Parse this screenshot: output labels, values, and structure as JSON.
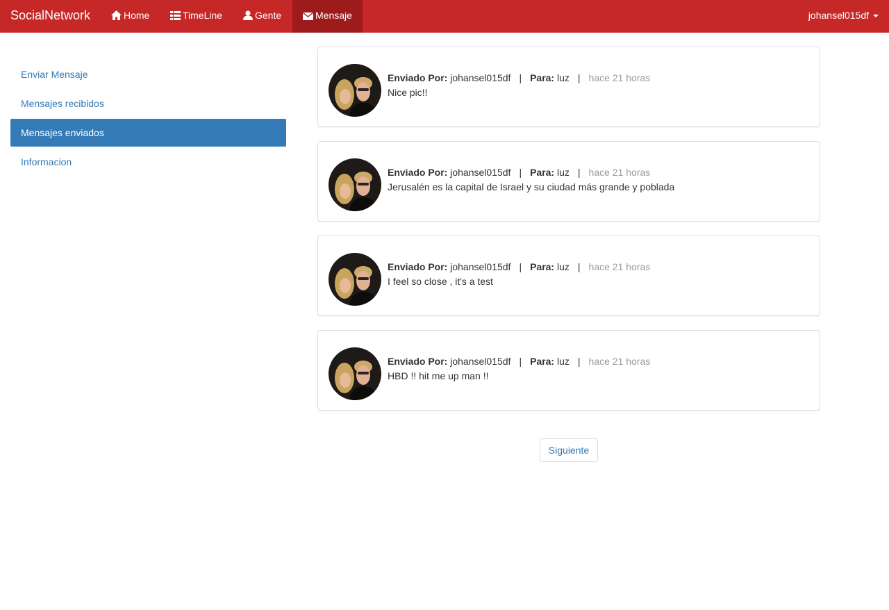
{
  "navbar": {
    "brand": "SocialNetwork",
    "items": [
      {
        "label": "Home",
        "icon": "home-icon"
      },
      {
        "label": "TimeLine",
        "icon": "list-icon"
      },
      {
        "label": "Gente",
        "icon": "user-icon"
      },
      {
        "label": "Mensaje",
        "icon": "envelope-icon",
        "active": true
      }
    ],
    "user": "johansel015df",
    "accent_color": "#c62828",
    "active_color": "#9e1b1b"
  },
  "sidebar": {
    "items": [
      {
        "label": "Enviar Mensaje"
      },
      {
        "label": "Mensajes recibidos"
      },
      {
        "label": "Mensajes enviados",
        "active": true
      },
      {
        "label": "Informacion"
      }
    ]
  },
  "messages": [
    {
      "sender_label": "Enviado Por:",
      "sender": "johansel015df",
      "to_label": "Para:",
      "to": "luz",
      "time": "hace 21 horas",
      "text": "Nice pic!!"
    },
    {
      "sender_label": "Enviado Por:",
      "sender": "johansel015df",
      "to_label": "Para:",
      "to": "luz",
      "time": "hace 21 horas",
      "text": "Jerusalén es la capital de Israel y su ciudad más grande y poblada"
    },
    {
      "sender_label": "Enviado Por:",
      "sender": "johansel015df",
      "to_label": "Para:",
      "to": "luz",
      "time": "hace 21 horas",
      "text": "I feel so close , it's a test"
    },
    {
      "sender_label": "Enviado Por:",
      "sender": "johansel015df",
      "to_label": "Para:",
      "to": "luz",
      "time": "hace 21 horas",
      "text": "HBD !! hit me up man !!"
    }
  ],
  "separator": "|",
  "pager": {
    "next_label": "Siguiente"
  }
}
